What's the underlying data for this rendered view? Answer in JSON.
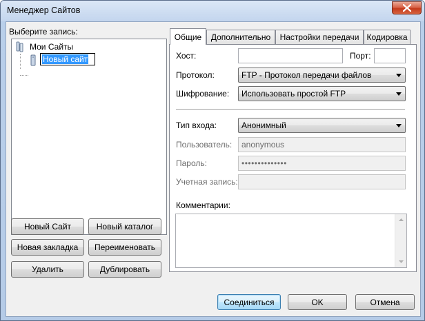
{
  "window": {
    "title": "Менеджер Сайтов"
  },
  "left": {
    "select_label": "Выберите запись:",
    "tree": {
      "root": "Мои Сайты",
      "editing_item": "Новый сайт"
    },
    "buttons": {
      "new_site": "Новый Сайт",
      "new_folder": "Новый каталог",
      "new_bookmark": "Новая закладка",
      "rename": "Переименовать",
      "delete": "Удалить",
      "duplicate": "Дублировать"
    }
  },
  "tabs": [
    {
      "label": "Общие",
      "active": true
    },
    {
      "label": "Дополнительно"
    },
    {
      "label": "Настройки передачи"
    },
    {
      "label": "Кодировка"
    }
  ],
  "general": {
    "host_label": "Хост:",
    "host_value": "",
    "port_label": "Порт:",
    "port_value": "",
    "protocol_label": "Протокол:",
    "protocol_value": "FTP - Протокол передачи файлов",
    "encryption_label": "Шифрование:",
    "encryption_value": "Использовать простой FTP",
    "logon_type_label": "Тип входа:",
    "logon_type_value": "Анонимный",
    "user_label": "Пользователь:",
    "user_value": "anonymous",
    "password_label": "Пароль:",
    "password_value": "••••••••••••••",
    "account_label": "Учетная запись:",
    "account_value": "",
    "comments_label": "Комментарии:",
    "comments_value": ""
  },
  "footer": {
    "connect": "Соединиться",
    "ok": "OK",
    "cancel": "Отмена"
  }
}
